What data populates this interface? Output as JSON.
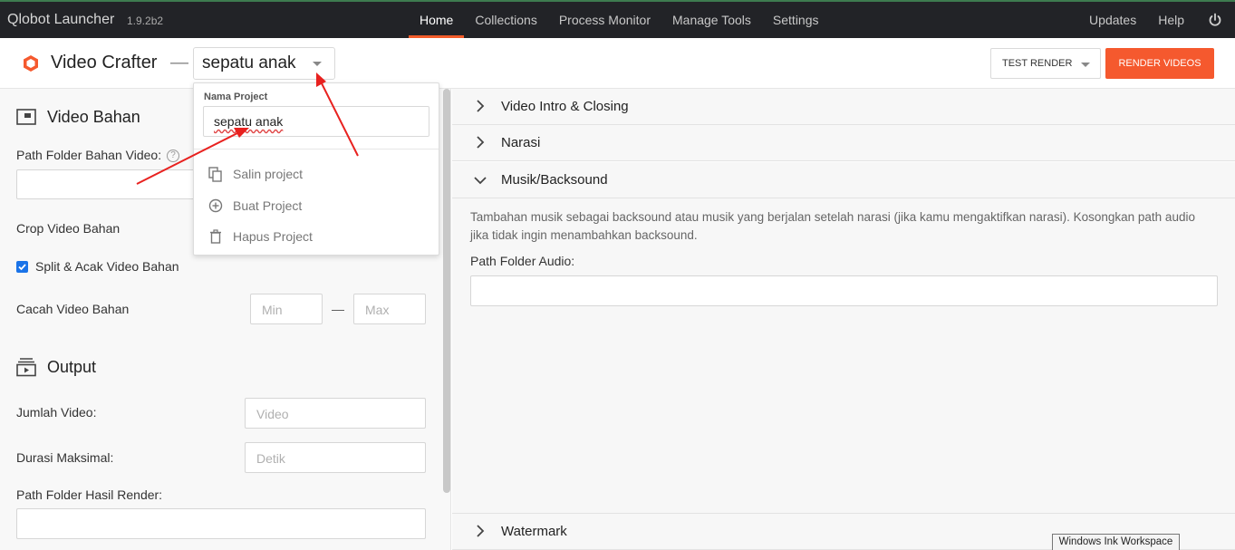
{
  "app": {
    "name": "Qlobot Launcher",
    "version": "1.9.2b2"
  },
  "nav": {
    "items": [
      "Home",
      "Collections",
      "Process Monitor",
      "Manage Tools",
      "Settings"
    ],
    "active": "Home"
  },
  "topRight": {
    "updates": "Updates",
    "help": "Help",
    "power_icon": "power-icon"
  },
  "header": {
    "title": "Video Crafter",
    "separator": "—",
    "project": "sepatu anak",
    "test_render": "TEST RENDER",
    "render_videos": "RENDER VIDEOS"
  },
  "left": {
    "video_bahan": {
      "title": "Video Bahan",
      "path_label": "Path Folder Bahan Video:",
      "help": "?",
      "crop_label": "Crop Video Bahan",
      "split_label": "Split & Acak Video Bahan",
      "split_checked": true,
      "cacah_label": "Cacah Video Bahan",
      "min_placeholder": "Min",
      "max_placeholder": "Max",
      "range_sep": "—"
    },
    "output": {
      "title": "Output",
      "jumlah_label": "Jumlah Video:",
      "jumlah_placeholder": "Video",
      "durasi_label": "Durasi Maksimal:",
      "durasi_placeholder": "Detik",
      "hasil_label": "Path Folder Hasil Render:"
    }
  },
  "right": {
    "sections": [
      "Video Intro & Closing",
      "Narasi",
      "Musik/Backsound",
      "Watermark"
    ],
    "expanded": "Musik/Backsound",
    "musik": {
      "description": "Tambahan musik sebagai backsound atau musik yang berjalan setelah narasi (jika kamu mengaktifkan narasi). Kosongkan path audio jika tidak ingin menambahkan backsound.",
      "path_label": "Path Folder Audio:"
    }
  },
  "dropdown": {
    "label": "Nama Project",
    "value": "sepatu anak",
    "items": [
      "Salin project",
      "Buat Project",
      "Hapus Project"
    ]
  },
  "tooltip": "Windows Ink Workspace",
  "colors": {
    "accent": "#f5592e",
    "topbar": "#222327",
    "annotation": "#e8211f"
  }
}
